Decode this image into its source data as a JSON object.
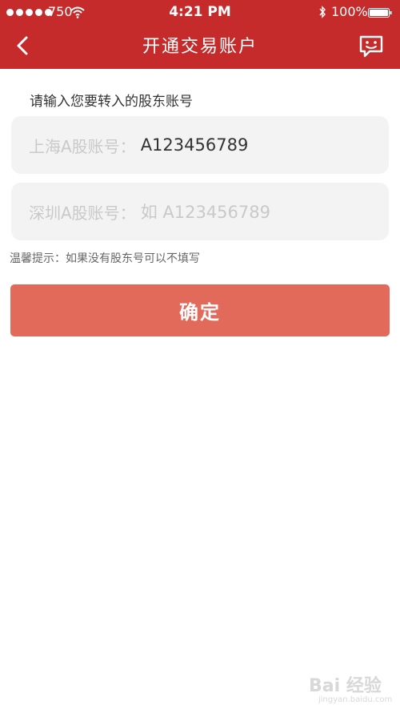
{
  "status_bar": {
    "carrier": "750",
    "time": "4:21 PM",
    "battery": "100%"
  },
  "nav": {
    "title": "开通交易账户"
  },
  "form": {
    "section_label": "请输入您要转入的股东账号",
    "shanghai": {
      "label": "上海A股账号：",
      "value": "A123456789"
    },
    "shenzhen": {
      "label": "深圳A股账号：",
      "placeholder": "如 A123456789"
    },
    "hint": "温馨提示：如果没有股东号可以不填写",
    "confirm_label": "确定"
  },
  "watermark": {
    "main": "Bai 经验",
    "sub": "jingyan.baidu.com"
  },
  "colors": {
    "header": "#c52b2b",
    "button": "#e26a5b",
    "input_bg": "#f3f3f3"
  },
  "icons": [
    "back-icon",
    "chat-icon",
    "wifi-icon",
    "bluetooth-icon",
    "battery-icon"
  ]
}
